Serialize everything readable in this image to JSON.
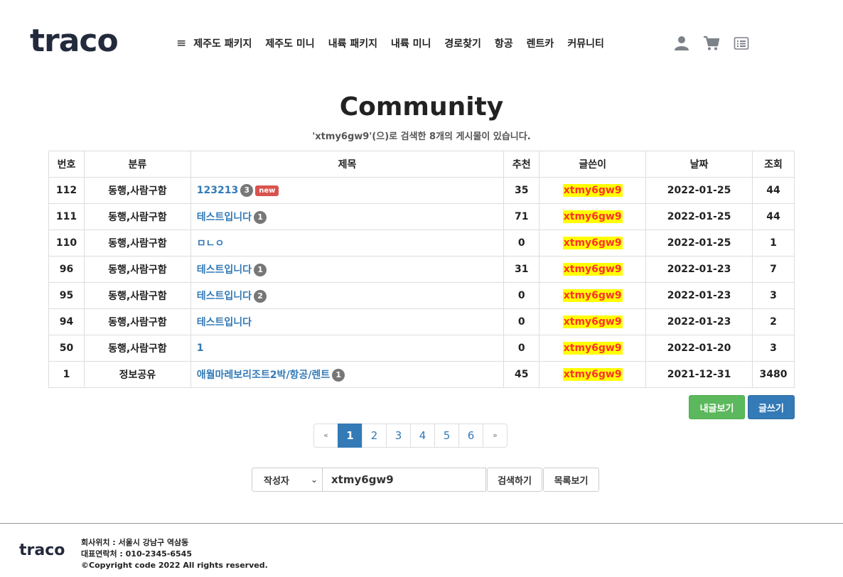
{
  "header": {
    "logo": "traco",
    "menu_icon": "≡",
    "nav": [
      "제주도 패키지",
      "제주도 미니",
      "내륙 패키지",
      "내륙 미니",
      "경로찾기",
      "항공",
      "렌트카",
      "커뮤니티"
    ],
    "icons": [
      "user-icon",
      "cart-icon",
      "list-icon"
    ]
  },
  "page": {
    "title": "Community",
    "subtitle": "'xtmy6gw9'(으)로 검색한 8개의 게시물이 있습니다."
  },
  "table": {
    "headers": [
      "번호",
      "분류",
      "제목",
      "추천",
      "글쓴이",
      "날짜",
      "조회"
    ],
    "rows": [
      {
        "no": "112",
        "category": "동행,사람구함",
        "title": "123213",
        "comments": "3",
        "new": "new",
        "likes": "35",
        "author": "xtmy6gw9",
        "date": "2022-01-25",
        "views": "44"
      },
      {
        "no": "111",
        "category": "동행,사람구함",
        "title": "테스트입니다",
        "comments": "1",
        "new": "",
        "likes": "71",
        "author": "xtmy6gw9",
        "date": "2022-01-25",
        "views": "44"
      },
      {
        "no": "110",
        "category": "동행,사람구함",
        "title": "ㅁㄴㅇ",
        "comments": "",
        "new": "",
        "likes": "0",
        "author": "xtmy6gw9",
        "date": "2022-01-25",
        "views": "1"
      },
      {
        "no": "96",
        "category": "동행,사람구함",
        "title": "테스트입니다",
        "comments": "1",
        "new": "",
        "likes": "31",
        "author": "xtmy6gw9",
        "date": "2022-01-23",
        "views": "7"
      },
      {
        "no": "95",
        "category": "동행,사람구함",
        "title": "테스트입니다",
        "comments": "2",
        "new": "",
        "likes": "0",
        "author": "xtmy6gw9",
        "date": "2022-01-23",
        "views": "3"
      },
      {
        "no": "94",
        "category": "동행,사람구함",
        "title": "테스트입니다",
        "comments": "",
        "new": "",
        "likes": "0",
        "author": "xtmy6gw9",
        "date": "2022-01-23",
        "views": "2"
      },
      {
        "no": "50",
        "category": "동행,사람구함",
        "title": "1",
        "comments": "",
        "new": "",
        "likes": "0",
        "author": "xtmy6gw9",
        "date": "2022-01-20",
        "views": "3"
      },
      {
        "no": "1",
        "category": "정보공유",
        "title": "애월마레보리조트2박/항공/렌트",
        "comments": "1",
        "new": "",
        "likes": "45",
        "author": "xtmy6gw9",
        "date": "2021-12-31",
        "views": "3480"
      }
    ]
  },
  "buttons": {
    "my_posts": "내글보기",
    "write": "글쓰기"
  },
  "pagination": {
    "prev": "«",
    "pages": [
      "1",
      "2",
      "3",
      "4",
      "5",
      "6"
    ],
    "active": "1",
    "next": "»"
  },
  "search": {
    "field_selected": "작성자",
    "query": "xtmy6gw9",
    "search_label": "검색하기",
    "list_label": "목록보기"
  },
  "footer": {
    "logo": "traco",
    "address": "회사위치 : 서울시 강남구 역삼동",
    "contact": "대표연락처 : 010-2345-6545",
    "copyright": "©Copyright code 2022 All rights reserved."
  },
  "colors": {
    "accent": "#337ab7",
    "green": "#5cb85c",
    "highlight_bg": "#ffff00",
    "highlight_text": "#ff3030",
    "new_badge": "#d9534f"
  }
}
